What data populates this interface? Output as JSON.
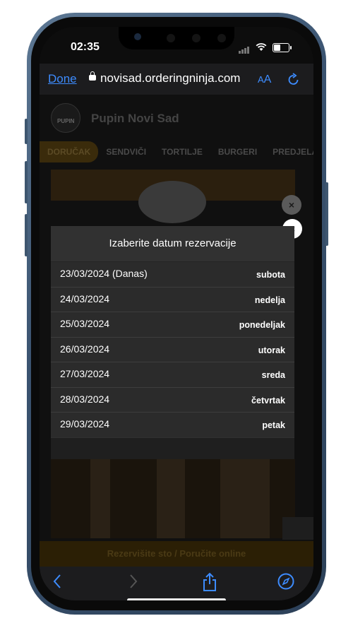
{
  "status_bar": {
    "time": "02:35"
  },
  "browser": {
    "done_label": "Done",
    "url": "novisad.orderingninja.com",
    "text_size_label_small": "A",
    "text_size_label_large": "A"
  },
  "page": {
    "logo_text": "PUPIN",
    "restaurant_name": "Pupin Novi Sad",
    "categories": [
      "DORUČAK",
      "SENDVIČI",
      "TORTILJE",
      "BURGERI",
      "PREDJELA"
    ],
    "reserve_label": "Rezervišite sto / Poručite online"
  },
  "modal": {
    "title": "Izaberite datum rezervacije",
    "close_symbol": "×",
    "dates": [
      {
        "date": "23/03/2024 (Danas)",
        "day": "subota"
      },
      {
        "date": "24/03/2024",
        "day": "nedelja"
      },
      {
        "date": "25/03/2024",
        "day": "ponedeljak"
      },
      {
        "date": "26/03/2024",
        "day": "utorak"
      },
      {
        "date": "27/03/2024",
        "day": "sreda"
      },
      {
        "date": "28/03/2024",
        "day": "četvrtak"
      },
      {
        "date": "29/03/2024",
        "day": "petak"
      }
    ]
  },
  "toolbar": {
    "icons": [
      "back-icon",
      "forward-icon",
      "share-icon",
      "compass-icon"
    ]
  },
  "colors": {
    "accent": "#3d8cff",
    "modal_bg": "#313131",
    "brand_orange": "#f2a623"
  }
}
